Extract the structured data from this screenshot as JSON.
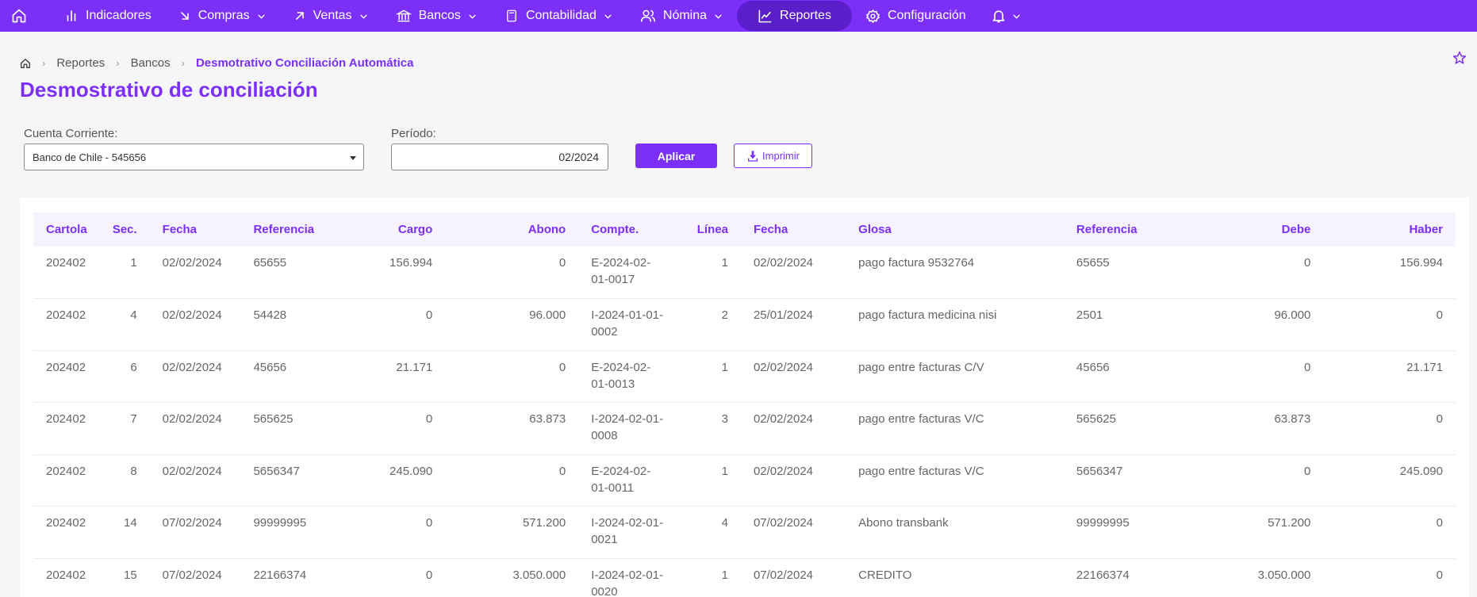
{
  "nav": {
    "items": [
      {
        "label": "Indicadores",
        "icon": "bar-chart-icon",
        "dropdown": false
      },
      {
        "label": "Compras",
        "icon": "arrow-down-right-icon",
        "dropdown": true
      },
      {
        "label": "Ventas",
        "icon": "arrow-up-right-icon",
        "dropdown": true
      },
      {
        "label": "Bancos",
        "icon": "bank-icon",
        "dropdown": true
      },
      {
        "label": "Contabilidad",
        "icon": "calculator-icon",
        "dropdown": true
      },
      {
        "label": "Nómina",
        "icon": "users-icon",
        "dropdown": true
      },
      {
        "label": "Reportes",
        "icon": "chart-line-icon",
        "dropdown": false,
        "active": true
      },
      {
        "label": "Configuración",
        "icon": "gear-icon",
        "dropdown": false
      }
    ]
  },
  "breadcrumb": {
    "items": [
      "Reportes",
      "Bancos"
    ],
    "current": "Desmotrativo Conciliación Automática"
  },
  "page": {
    "title": "Desmostrativo de conciliación"
  },
  "filters": {
    "account_label": "Cuenta Corriente:",
    "account_value": "Banco de Chile - 545656",
    "period_label": "Período:",
    "period_value": "02/2024",
    "apply_label": "Aplicar",
    "print_label": "Imprimir"
  },
  "table": {
    "headers": [
      "Cartola",
      "Sec.",
      "Fecha",
      "Referencia",
      "Cargo",
      "Abono",
      "Compte.",
      "Línea",
      "Fecha",
      "Glosa",
      "Referencia",
      "Debe",
      "Haber"
    ],
    "rows": [
      [
        "202402",
        "1",
        "02/02/2024",
        "65655",
        "156.994",
        "0",
        "E-2024-02-01-0017",
        "1",
        "02/02/2024",
        "pago factura 9532764",
        "65655",
        "0",
        "156.994"
      ],
      [
        "202402",
        "4",
        "02/02/2024",
        "54428",
        "0",
        "96.000",
        "I-2024-01-01-0002",
        "2",
        "25/01/2024",
        "pago factura medicina nisi",
        "2501",
        "96.000",
        "0"
      ],
      [
        "202402",
        "6",
        "02/02/2024",
        "45656",
        "21.171",
        "0",
        "E-2024-02-01-0013",
        "1",
        "02/02/2024",
        "pago entre facturas C/V",
        "45656",
        "0",
        "21.171"
      ],
      [
        "202402",
        "7",
        "02/02/2024",
        "565625",
        "0",
        "63.873",
        "I-2024-02-01-0008",
        "3",
        "02/02/2024",
        "pago entre facturas V/C",
        "565625",
        "63.873",
        "0"
      ],
      [
        "202402",
        "8",
        "02/02/2024",
        "5656347",
        "245.090",
        "0",
        "E-2024-02-01-0011",
        "1",
        "02/02/2024",
        "pago entre facturas V/C",
        "5656347",
        "0",
        "245.090"
      ],
      [
        "202402",
        "14",
        "07/02/2024",
        "99999995",
        "0",
        "571.200",
        "I-2024-02-01-0021",
        "4",
        "07/02/2024",
        "Abono transbank",
        "99999995",
        "571.200",
        "0"
      ],
      [
        "202402",
        "15",
        "07/02/2024",
        "22166374",
        "0",
        "3.050.000",
        "I-2024-02-01-0020",
        "1",
        "07/02/2024",
        "CREDITO",
        "22166374",
        "3.050.000",
        "0"
      ]
    ]
  }
}
